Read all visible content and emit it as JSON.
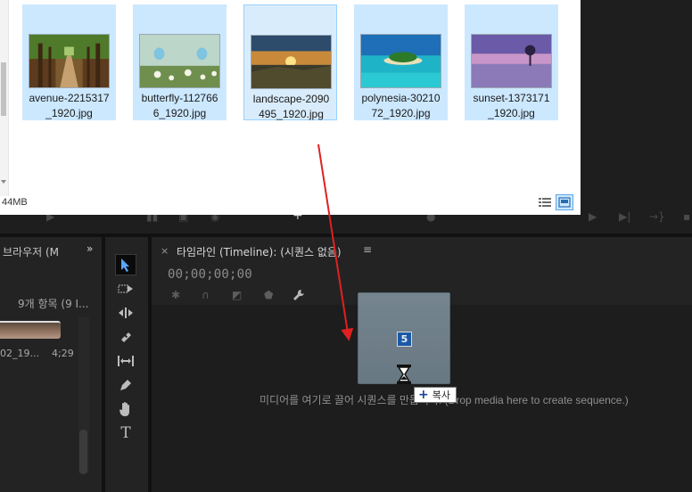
{
  "explorer": {
    "files": [
      {
        "name": "avenue-2215317_1920.jpg",
        "line1": "avenue-2215317",
        "line2": "_1920.jpg"
      },
      {
        "name": "butterfly-1127666_1920.jpg",
        "line1": "butterfly-112766",
        "line2": "6_1920.jpg"
      },
      {
        "name": "landscape-2090495_1920.jpg",
        "line1": "landscape-2090",
        "line2": "495_1920.jpg"
      },
      {
        "name": "polynesia-3021072_1920.jpg",
        "line1": "polynesia-30210",
        "line2": "72_1920.jpg"
      },
      {
        "name": "sunset-1373171_1920.jpg",
        "line1": "sunset-1373171",
        "line2": "_1920.jpg"
      }
    ],
    "status_size": "44MB",
    "view_icons": [
      "details-view-icon",
      "large-icons-view-icon"
    ]
  },
  "browser": {
    "title": "브라우저 (M",
    "more": "»",
    "item_count": "9개 항목 (9 I...",
    "clip_name": "02_19...",
    "clip_duration": "4;29"
  },
  "tools": [
    "selection-tool-icon",
    "track-select-forward-icon",
    "ripple-edit-icon",
    "razor-icon",
    "slip-icon",
    "pen-icon",
    "hand-icon",
    "type-icon"
  ],
  "timeline": {
    "close": "×",
    "title": "타임라인 (Timeline): (시퀀스 없음)",
    "menu": "≡",
    "timecode": "00;00;00;00",
    "drop_hint": "미디어를 여기로 끌어 시퀀스를 만듭니다. (Drop media here to create sequence.)"
  },
  "drag": {
    "count": "5",
    "copy_plus": "+",
    "copy_label": "복사"
  },
  "colors": {
    "selection": "#cce8ff",
    "arrow": "#e02020",
    "badge": "#1b5fb4"
  }
}
